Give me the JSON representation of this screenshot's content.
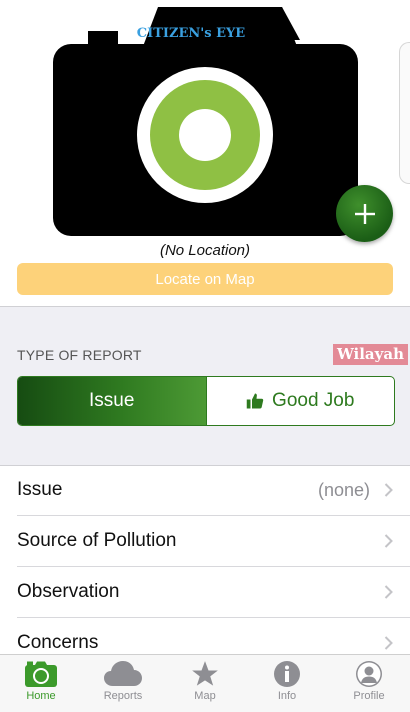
{
  "header": {
    "camera_logo_text": "CITIZEN's EYE",
    "location_text": "(No Location)",
    "locate_button_label": "Locate on Map"
  },
  "report_type": {
    "section_label": "TYPE OF REPORT",
    "watermark": "Wilayah",
    "options": [
      {
        "label": "Issue",
        "selected": true
      },
      {
        "label": "Good Job",
        "icon": "thumbs-up-icon",
        "selected": false
      }
    ]
  },
  "list": {
    "rows": [
      {
        "label": "Issue",
        "value": "(none)"
      },
      {
        "label": "Source of Pollution"
      },
      {
        "label": "Observation"
      },
      {
        "label": "Concerns"
      }
    ]
  },
  "tabbar": {
    "tabs": [
      {
        "label": "Home",
        "icon": "camera-icon",
        "active": true
      },
      {
        "label": "Reports",
        "icon": "cloud-icon"
      },
      {
        "label": "Map",
        "icon": "star-icon"
      },
      {
        "label": "Info",
        "icon": "info-icon"
      },
      {
        "label": "Profile",
        "icon": "profile-icon"
      }
    ]
  },
  "colors": {
    "accent_green": "#2e7a1f",
    "locate_button": "#fdd27a",
    "camera_lens_green": "#8fc044"
  }
}
